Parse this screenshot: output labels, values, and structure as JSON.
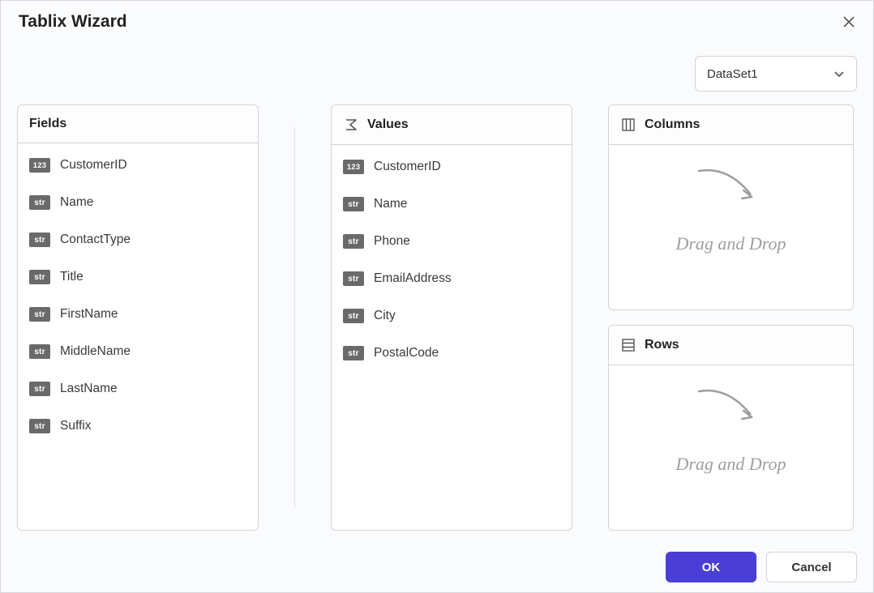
{
  "window": {
    "title": "Tablix Wizard"
  },
  "dataset": {
    "selected": "DataSet1"
  },
  "panels": {
    "fields_title": "Fields",
    "values_title": "Values",
    "columns_title": "Columns",
    "rows_title": "Rows"
  },
  "dropzone_hint": "Drag and Drop",
  "fields": [
    {
      "type": "123",
      "label": "CustomerID"
    },
    {
      "type": "str",
      "label": "Name"
    },
    {
      "type": "str",
      "label": "ContactType"
    },
    {
      "type": "str",
      "label": "Title"
    },
    {
      "type": "str",
      "label": "FirstName"
    },
    {
      "type": "str",
      "label": "MiddleName"
    },
    {
      "type": "str",
      "label": "LastName"
    },
    {
      "type": "str",
      "label": "Suffix"
    }
  ],
  "values": [
    {
      "type": "123",
      "label": "CustomerID"
    },
    {
      "type": "str",
      "label": "Name"
    },
    {
      "type": "str",
      "label": "Phone"
    },
    {
      "type": "str",
      "label": "EmailAddress"
    },
    {
      "type": "str",
      "label": "City"
    },
    {
      "type": "str",
      "label": "PostalCode"
    }
  ],
  "buttons": {
    "ok": "OK",
    "cancel": "Cancel"
  }
}
